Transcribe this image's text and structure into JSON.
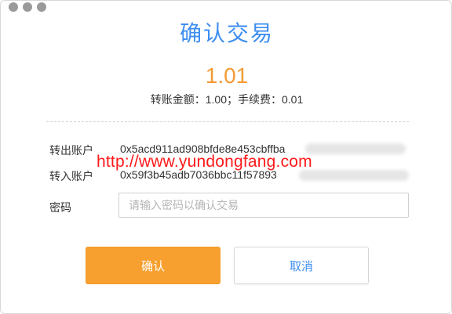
{
  "window": {
    "title": "确认交易"
  },
  "transaction": {
    "total": "1.01",
    "amount_label": "转账金额：",
    "amount": "1.00",
    "separator": "；",
    "fee_label": "手续费：",
    "fee": "0.01"
  },
  "from_account": {
    "label": "转出账户",
    "address_visible": "0x5acd911ad908bfde8e453cbffba"
  },
  "to_account": {
    "label": "转入账户",
    "address_visible": "0x59f3b45adb7036bbc11f57893"
  },
  "password": {
    "label": "密码",
    "placeholder": "请输入密码以确认交易",
    "value": ""
  },
  "watermark": "http://www.yundongfang.com",
  "buttons": {
    "confirm": "确认",
    "cancel": "取消"
  },
  "colors": {
    "title": "#3d8ef0",
    "total": "#f39b34",
    "confirm_bg": "#f7a030",
    "cancel_text": "#3d8ef0",
    "watermark": "#ff1a1a"
  },
  "icons": [
    "window-dot-icon",
    "window-dot-icon",
    "window-dot-icon"
  ]
}
